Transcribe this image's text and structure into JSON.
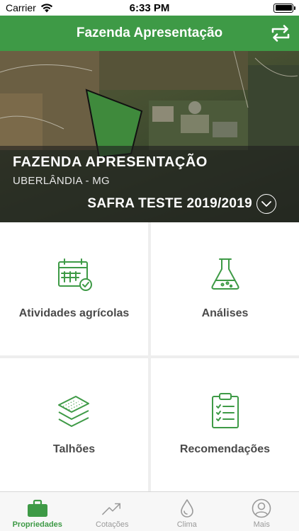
{
  "status_bar": {
    "carrier": "Carrier",
    "time": "6:33 PM"
  },
  "nav": {
    "title": "Fazenda Apresentação",
    "swap_icon": "swap-arrows-icon"
  },
  "farm": {
    "name": "FAZENDA APRESENTAÇÃO",
    "location": "UBERLÂNDIA - MG",
    "season": "SAFRA TESTE 2019/2019"
  },
  "menu": {
    "items": [
      {
        "label": "Atividades agrícolas",
        "icon": "calendar-check-icon"
      },
      {
        "label": "Análises",
        "icon": "flask-icon"
      },
      {
        "label": "Talhões",
        "icon": "layers-icon"
      },
      {
        "label": "Recomendações",
        "icon": "clipboard-list-icon"
      }
    ]
  },
  "tabs": [
    {
      "label": "Propriedades",
      "icon": "briefcase-icon",
      "active": true
    },
    {
      "label": "Cotações",
      "icon": "trend-up-icon",
      "active": false
    },
    {
      "label": "Clima",
      "icon": "drop-icon",
      "active": false
    },
    {
      "label": "Mais",
      "icon": "user-icon",
      "active": false
    }
  ],
  "colors": {
    "primary": "#3e9a46",
    "inactive": "#9a9a9a",
    "label": "#4a4a4a"
  }
}
